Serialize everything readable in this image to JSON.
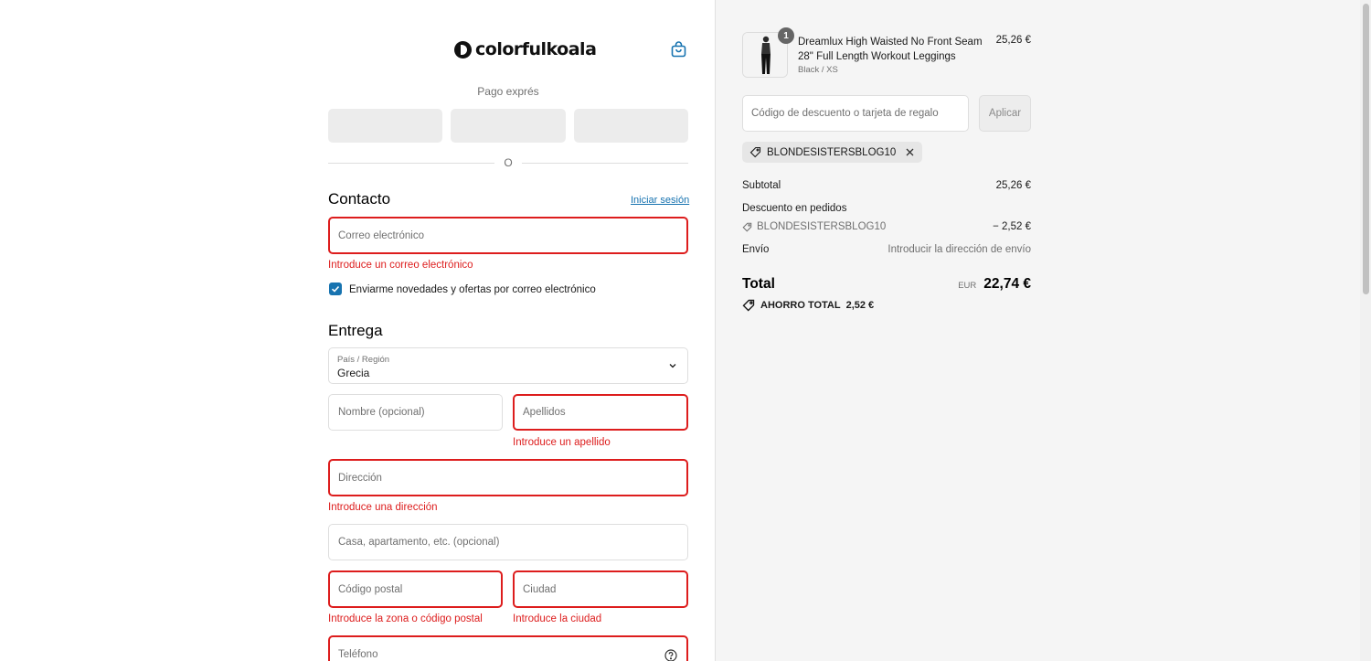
{
  "header": {
    "brand": "colorfulkoala",
    "cart_icon": "shopping-bag-icon"
  },
  "express": {
    "title": "Pago exprés",
    "divider": "O"
  },
  "contact": {
    "heading": "Contacto",
    "login_link": "Iniciar sesión",
    "email_placeholder": "Correo electrónico",
    "email_error": "Introduce un correo electrónico",
    "newsletter_label": "Enviarme novedades y ofertas por correo electrónico",
    "newsletter_checked": true
  },
  "delivery": {
    "heading": "Entrega",
    "country_label": "País / Región",
    "country_value": "Grecia",
    "first_name_placeholder": "Nombre (opcional)",
    "last_name_placeholder": "Apellidos",
    "last_name_error": "Introduce un apellido",
    "address_placeholder": "Dirección",
    "address_error": "Introduce una dirección",
    "apartment_placeholder": "Casa, apartamento, etc. (opcional)",
    "postal_placeholder": "Código postal",
    "postal_error": "Introduce la zona o código postal",
    "city_placeholder": "Ciudad",
    "city_error": "Introduce la ciudad",
    "phone_placeholder": "Teléfono"
  },
  "summary": {
    "product": {
      "quantity": "1",
      "name": "Dreamlux High Waisted No Front Seam 28\" Full Length Workout Leggings",
      "variant": "Black / XS",
      "price": "25,26 €"
    },
    "discount_placeholder": "Código de descuento o tarjeta de regalo",
    "apply_label": "Aplicar",
    "applied_code": "BLONDESISTERSBLOG10",
    "subtotal_label": "Subtotal",
    "subtotal_value": "25,26 €",
    "order_discount_label": "Descuento en pedidos",
    "order_discount_code": "BLONDESISTERSBLOG10",
    "order_discount_value": "− 2,52 €",
    "shipping_label": "Envío",
    "shipping_value": "Introducir la dirección de envío",
    "total_label": "Total",
    "currency": "EUR",
    "total_value": "22,74 €",
    "savings_label": "AHORRO TOTAL",
    "savings_value": "2,52 €"
  },
  "colors": {
    "accent": "#1773b0",
    "error": "#dd1d1d",
    "summary_bg": "#f5f5f5"
  }
}
